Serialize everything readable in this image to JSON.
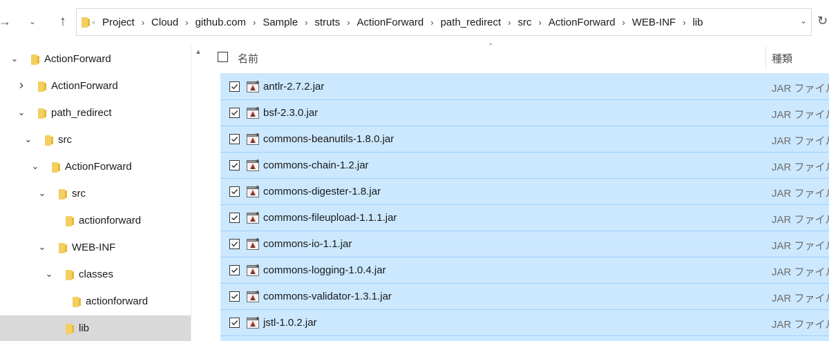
{
  "address": {
    "breadcrumbs": [
      "Project",
      "Cloud",
      "github.com",
      "Sample",
      "struts",
      "ActionForward",
      "path_redirect",
      "src",
      "ActionForward",
      "WEB-INF",
      "lib"
    ]
  },
  "icons": {
    "back": "back-arrow-icon",
    "dropdown": "chevron-down-icon",
    "up": "up-arrow-icon",
    "refresh": "refresh-icon",
    "folder": "folder-icon",
    "jar": "jar-file-icon"
  },
  "tree": {
    "items": [
      {
        "label": "ActionForward",
        "expanded": true
      },
      {
        "label": "ActionForward",
        "expanded": false
      },
      {
        "label": "path_redirect",
        "expanded": true
      },
      {
        "label": "src",
        "expanded": true
      },
      {
        "label": "ActionForward",
        "expanded": true
      },
      {
        "label": "src",
        "expanded": true
      },
      {
        "label": "actionforward",
        "expanded": null
      },
      {
        "label": "WEB-INF",
        "expanded": true
      },
      {
        "label": "classes",
        "expanded": true
      },
      {
        "label": "actionforward",
        "expanded": null
      },
      {
        "label": "lib",
        "expanded": null,
        "selected": true
      }
    ]
  },
  "list": {
    "columns": {
      "name": "名前",
      "type": "種類"
    },
    "files": [
      {
        "name": "antlr-2.7.2.jar",
        "type": "JAR ファイル",
        "checked": true
      },
      {
        "name": "bsf-2.3.0.jar",
        "type": "JAR ファイル",
        "checked": true
      },
      {
        "name": "commons-beanutils-1.8.0.jar",
        "type": "JAR ファイル",
        "checked": true
      },
      {
        "name": "commons-chain-1.2.jar",
        "type": "JAR ファイル",
        "checked": true
      },
      {
        "name": "commons-digester-1.8.jar",
        "type": "JAR ファイル",
        "checked": true
      },
      {
        "name": "commons-fileupload-1.1.1.jar",
        "type": "JAR ファイル",
        "checked": true
      },
      {
        "name": "commons-io-1.1.jar",
        "type": "JAR ファイル",
        "checked": true
      },
      {
        "name": "commons-logging-1.0.4.jar",
        "type": "JAR ファイル",
        "checked": true
      },
      {
        "name": "commons-validator-1.3.1.jar",
        "type": "JAR ファイル",
        "checked": true
      },
      {
        "name": "jstl-1.0.2.jar",
        "type": "JAR ファイル",
        "checked": true
      }
    ]
  },
  "colors": {
    "selection": "#cce8ff",
    "selection_border": "#99d1ff",
    "tree_selected": "#d9d9d9",
    "folder": "#f3cf61"
  }
}
